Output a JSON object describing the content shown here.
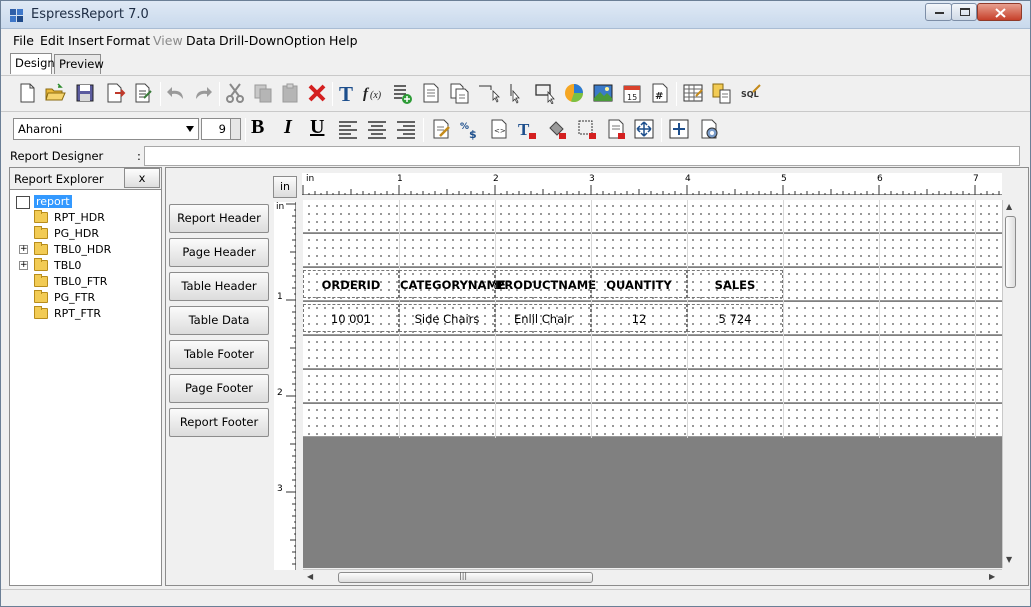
{
  "window": {
    "title": "EspressReport 7.0",
    "controls": {
      "minimize": "–",
      "maximize": "□",
      "close": "✕"
    }
  },
  "menu": {
    "items": [
      {
        "label": "File"
      },
      {
        "label": "Edit"
      },
      {
        "label": "Insert"
      },
      {
        "label": "Format"
      },
      {
        "label": "View",
        "disabled": true
      },
      {
        "label": "Data"
      },
      {
        "label": "Drill-Down"
      },
      {
        "label": "Option"
      },
      {
        "label": "Help"
      }
    ]
  },
  "tabs": {
    "design": "Design",
    "preview": "Preview",
    "active": "design"
  },
  "toolbar1": {
    "icons": [
      "new-file-icon",
      "open-folder-icon",
      "save-icon",
      "export-icon",
      "page-setup-icon",
      "undo-icon",
      "redo-icon",
      "cut-icon",
      "copy-icon",
      "paste-icon",
      "delete-icon",
      "insert-label-icon",
      "insert-formula-icon",
      "insert-column-icon",
      "insert-report-icon",
      "insert-subreport-icon",
      "insert-line-icon",
      "select-pointer-icon",
      "insert-rectangle-icon",
      "insert-chart-icon",
      "insert-image-icon",
      "insert-date-icon",
      "insert-page-number-icon",
      "table-properties-icon",
      "data-source-icon",
      "sql-icon"
    ],
    "sql_label": "SQL"
  },
  "toolbar2": {
    "font_name": "Aharoni",
    "font_size": "9",
    "bold": "B",
    "italic": "I",
    "underline": "U",
    "icons": [
      "align-left-icon",
      "align-center-icon",
      "align-right-icon",
      "edit-format-icon",
      "number-format-icon",
      "html-format-icon",
      "text-color-icon",
      "fill-color-icon",
      "border-icon",
      "background-icon",
      "fit-icon",
      "expand-icon",
      "settings-icon"
    ]
  },
  "designer": {
    "label": "Report Designer",
    "colon": ":",
    "value": ""
  },
  "explorer": {
    "title": "Report Explorer",
    "close_label": "x",
    "root": "report",
    "nodes": [
      {
        "label": "RPT_HDR",
        "expandable": false
      },
      {
        "label": "PG_HDR",
        "expandable": false
      },
      {
        "label": "TBL0_HDR",
        "expandable": true
      },
      {
        "label": "TBL0",
        "expandable": true
      },
      {
        "label": "TBL0_FTR",
        "expandable": false
      },
      {
        "label": "PG_FTR",
        "expandable": false
      },
      {
        "label": "RPT_FTR",
        "expandable": false
      }
    ]
  },
  "sections": [
    "Report Header",
    "Page Header",
    "Table Header",
    "Table Data",
    "Table Footer",
    "Page Footer",
    "Report Footer"
  ],
  "ruler": {
    "unit": "in",
    "h_labels": [
      "in",
      "1",
      "2",
      "3",
      "4",
      "5",
      "6",
      "7"
    ],
    "v_labels": [
      "in",
      "1",
      "2",
      "3"
    ]
  },
  "table": {
    "headers": [
      "ORDERID",
      "CATEGORYNAME",
      "PRODUCTNAME",
      "QUANTITY",
      "SALES"
    ],
    "row": [
      "10 001",
      "Side Chairs",
      "Enlil Chair",
      "12",
      "5 724"
    ]
  },
  "scrollbar": {
    "grip": "|||"
  }
}
